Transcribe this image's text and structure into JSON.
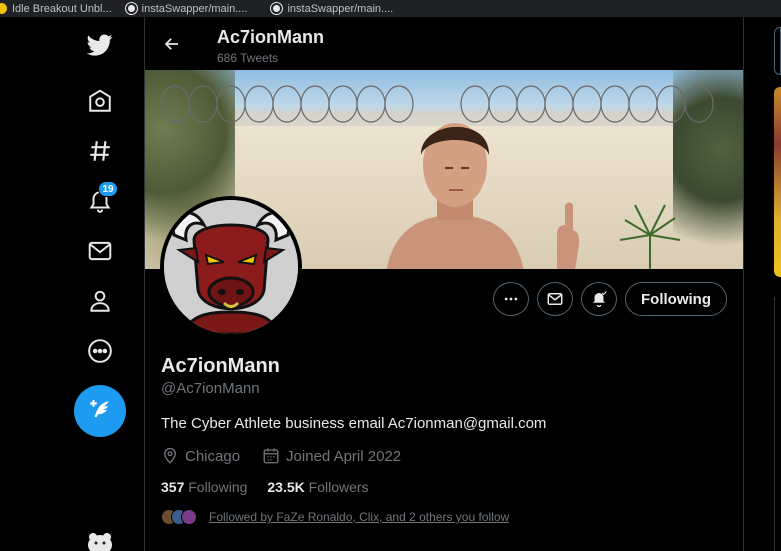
{
  "bookmarks": [
    {
      "label": "Idle Breakout Unbl...",
      "icon": "yellow-icon"
    },
    {
      "label": "instaSwapper/main....",
      "icon": "github-icon"
    },
    {
      "label": "instaSwapper/main....",
      "icon": "github-icon"
    }
  ],
  "nav": {
    "notifications_badge": "19"
  },
  "header": {
    "name": "Ac7ionMann",
    "tweet_count": "686 Tweets"
  },
  "actions": {
    "follow_label": "Following"
  },
  "profile": {
    "name": "Ac7ionMann",
    "handle": "@Ac7ionMann",
    "bio": "The Cyber Athlete business email Ac7ionman@gmail.com",
    "location": "Chicago",
    "joined": "Joined April 2022",
    "following_count": "357",
    "following_label": "Following",
    "followers_count": "23.5K",
    "followers_label": "Followers",
    "followed_by": "Followed by FaZe Ronaldo, Clix, and 2 others you follow"
  },
  "colors": {
    "accent": "#1d9bf0",
    "background": "#000000",
    "secondary_text": "#71767b"
  }
}
